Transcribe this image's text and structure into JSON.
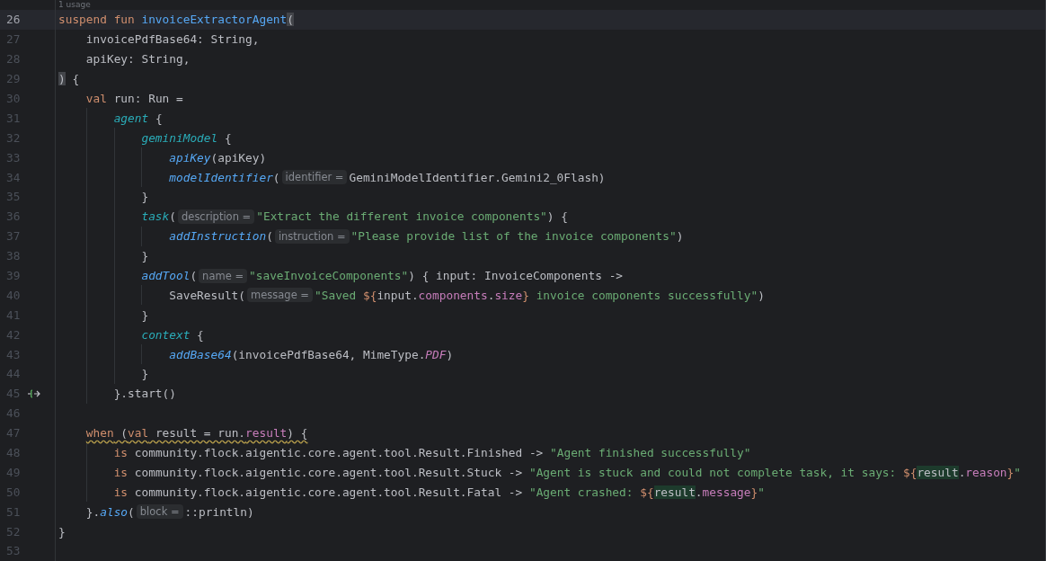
{
  "usage_hint": "1 usage",
  "lines": [
    {
      "number": "26",
      "current": true,
      "tokens": [
        {
          "kind": "keyword",
          "text": "suspend fun "
        },
        {
          "kind": "function",
          "text": "invoiceExtractorAgent"
        },
        {
          "kind": "match",
          "text": "("
        }
      ]
    },
    {
      "number": "27",
      "current": false,
      "tokens": [
        {
          "kind": "plain",
          "text": "    invoicePdfBase64: String,"
        }
      ]
    },
    {
      "number": "28",
      "current": false,
      "tokens": [
        {
          "kind": "plain",
          "text": "    apiKey: String,"
        }
      ]
    },
    {
      "number": "29",
      "current": false,
      "tokens": [
        {
          "kind": "match",
          "text": ")"
        },
        {
          "kind": "plain",
          "text": " {"
        }
      ]
    },
    {
      "number": "30",
      "current": false,
      "tokens": [
        {
          "kind": "keyword",
          "text": "    val"
        },
        {
          "kind": "plain",
          "text": " run: Run ="
        }
      ]
    },
    {
      "number": "31",
      "current": false,
      "tokens": [
        {
          "kind": "dsl",
          "text": "        agent"
        },
        {
          "kind": "plain",
          "text": " {"
        }
      ]
    },
    {
      "number": "32",
      "current": false,
      "tokens": [
        {
          "kind": "dsl",
          "text": "            geminiModel"
        },
        {
          "kind": "plain",
          "text": " {"
        }
      ]
    },
    {
      "number": "33",
      "current": false,
      "tokens": [
        {
          "kind": "call",
          "text": "                apiKey"
        },
        {
          "kind": "plain",
          "text": "(apiKey)"
        }
      ]
    },
    {
      "number": "34",
      "current": false,
      "tokens": [
        {
          "kind": "call",
          "text": "                modelIdentifier"
        },
        {
          "kind": "plain",
          "text": "("
        },
        {
          "kind": "hint",
          "text": "identifier ="
        },
        {
          "kind": "plain",
          "text": "GeminiModelIdentifier.Gemini2_0Flash)"
        }
      ]
    },
    {
      "number": "35",
      "current": false,
      "tokens": [
        {
          "kind": "plain",
          "text": "            }"
        }
      ]
    },
    {
      "number": "36",
      "current": false,
      "tokens": [
        {
          "kind": "dsl",
          "text": "            task"
        },
        {
          "kind": "plain",
          "text": "("
        },
        {
          "kind": "hint",
          "text": "description ="
        },
        {
          "kind": "string",
          "text": "\"Extract the different invoice components\""
        },
        {
          "kind": "plain",
          "text": ") {"
        }
      ]
    },
    {
      "number": "37",
      "current": false,
      "tokens": [
        {
          "kind": "call",
          "text": "                addInstruction"
        },
        {
          "kind": "plain",
          "text": "("
        },
        {
          "kind": "hint",
          "text": "instruction ="
        },
        {
          "kind": "string",
          "text": "\"Please provide list of the invoice components\""
        },
        {
          "kind": "plain",
          "text": ")"
        }
      ]
    },
    {
      "number": "38",
      "current": false,
      "tokens": [
        {
          "kind": "plain",
          "text": "            }"
        }
      ]
    },
    {
      "number": "39",
      "current": false,
      "tokens": [
        {
          "kind": "call",
          "text": "            addTool"
        },
        {
          "kind": "plain",
          "text": "("
        },
        {
          "kind": "hint",
          "text": "name ="
        },
        {
          "kind": "string",
          "text": "\"saveInvoiceComponents\""
        },
        {
          "kind": "plain",
          "text": ") { input: InvoiceComponents ->"
        }
      ]
    },
    {
      "number": "40",
      "current": false,
      "tokens": [
        {
          "kind": "plain",
          "text": "                SaveResult("
        },
        {
          "kind": "hint",
          "text": "message ="
        },
        {
          "kind": "string",
          "text": "\"Saved "
        },
        {
          "kind": "interp",
          "text": "${"
        },
        {
          "kind": "plain",
          "text": "input."
        },
        {
          "kind": "property",
          "text": "components"
        },
        {
          "kind": "plain",
          "text": "."
        },
        {
          "kind": "property",
          "text": "size"
        },
        {
          "kind": "interp",
          "text": "}"
        },
        {
          "kind": "string",
          "text": " invoice components successfully\""
        },
        {
          "kind": "plain",
          "text": ")"
        }
      ]
    },
    {
      "number": "41",
      "current": false,
      "tokens": [
        {
          "kind": "plain",
          "text": "            }"
        }
      ]
    },
    {
      "number": "42",
      "current": false,
      "tokens": [
        {
          "kind": "dsl",
          "text": "            context"
        },
        {
          "kind": "plain",
          "text": " {"
        }
      ]
    },
    {
      "number": "43",
      "current": false,
      "tokens": [
        {
          "kind": "call",
          "text": "                addBase64"
        },
        {
          "kind": "plain",
          "text": "(invoicePdfBase64, MimeType."
        },
        {
          "kind": "constant",
          "text": "PDF"
        },
        {
          "kind": "plain",
          "text": ")"
        }
      ]
    },
    {
      "number": "44",
      "current": false,
      "tokens": [
        {
          "kind": "plain",
          "text": "            }"
        }
      ]
    },
    {
      "number": "45",
      "current": false,
      "gutter": {
        "kind": "suspend-call"
      },
      "tokens": [
        {
          "kind": "plain",
          "text": "        }.start()"
        }
      ]
    },
    {
      "number": "46",
      "current": false
    },
    {
      "number": "47",
      "current": false,
      "warning": true,
      "tokens": [
        {
          "kind": "keyword",
          "text": "    when"
        },
        {
          "kind": "plain",
          "text": " ("
        },
        {
          "kind": "keyword",
          "text": "val"
        },
        {
          "kind": "plain",
          "text": " result = run."
        },
        {
          "kind": "property",
          "text": "result"
        },
        {
          "kind": "plain",
          "text": ") {"
        }
      ]
    },
    {
      "number": "48",
      "current": false,
      "tokens": [
        {
          "kind": "keyword",
          "text": "        is"
        },
        {
          "kind": "plain",
          "text": " community.flock.aigentic.core.agent.tool.Result.Finished -> "
        },
        {
          "kind": "string",
          "text": "\"Agent finished successfully\""
        }
      ]
    },
    {
      "number": "49",
      "current": false,
      "tokens": [
        {
          "kind": "keyword",
          "text": "        is"
        },
        {
          "kind": "plain",
          "text": " community.flock.aigentic.core.agent.tool.Result.Stuck -> "
        },
        {
          "kind": "string",
          "text": "\"Agent is stuck and could not complete task, it says: "
        },
        {
          "kind": "interp",
          "text": "${"
        },
        {
          "kind": "highlight",
          "text": "result"
        },
        {
          "kind": "plain",
          "text": "."
        },
        {
          "kind": "property",
          "text": "reason"
        },
        {
          "kind": "interp",
          "text": "}"
        },
        {
          "kind": "string",
          "text": "\""
        }
      ]
    },
    {
      "number": "50",
      "current": false,
      "tokens": [
        {
          "kind": "keyword",
          "text": "        is"
        },
        {
          "kind": "plain",
          "text": " community.flock.aigentic.core.agent.tool.Result.Fatal -> "
        },
        {
          "kind": "string",
          "text": "\"Agent crashed: "
        },
        {
          "kind": "interp",
          "text": "${"
        },
        {
          "kind": "highlight",
          "text": "result"
        },
        {
          "kind": "plain",
          "text": "."
        },
        {
          "kind": "property",
          "text": "message"
        },
        {
          "kind": "interp",
          "text": "}"
        },
        {
          "kind": "string",
          "text": "\""
        }
      ]
    },
    {
      "number": "51",
      "current": false,
      "tokens": [
        {
          "kind": "plain",
          "text": "    }."
        },
        {
          "kind": "call",
          "text": "also"
        },
        {
          "kind": "plain",
          "text": "("
        },
        {
          "kind": "hint",
          "text": "block ="
        },
        {
          "kind": "plain",
          "text": "::println)"
        }
      ]
    },
    {
      "number": "52",
      "current": false,
      "tokens": [
        {
          "kind": "plain",
          "text": "}"
        }
      ]
    },
    {
      "number": "53",
      "current": false
    }
  ]
}
